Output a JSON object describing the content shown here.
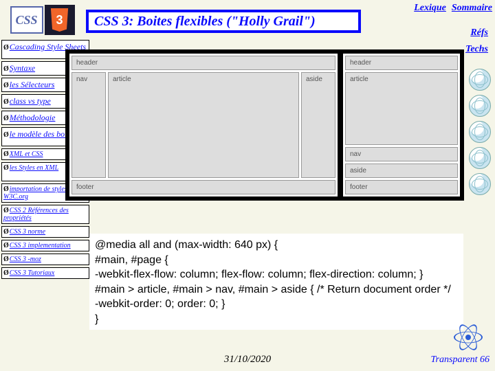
{
  "header": {
    "css_logo_text": "CSS",
    "shield_text": "3",
    "title": "CSS 3: Boites flexibles (\"Holly Grail\")",
    "lexique": "Lexique",
    "sommaire": "Sommaire",
    "refs": "Réfs",
    "techs": "Techs"
  },
  "sidebar": {
    "items": [
      "Cascading Style Sheets",
      "Syntaxe",
      "les Sélecteurs",
      "class vs type",
      "Méthodologie",
      "le modèle des boites",
      "XML et CSS",
      "les Styles en XML",
      "importation de styles W3C.org",
      "CSS 2 Références des propriétés",
      "CSS 3 norme",
      "CSS 3 implementation",
      "CSS 3 -moz",
      "CSS 3 Tutoriaux"
    ]
  },
  "diagram": {
    "left": {
      "header": "header",
      "nav": "nav",
      "article": "article",
      "aside": "aside",
      "footer": "footer"
    },
    "right": {
      "header": "header",
      "nav": "nav",
      "article": "article",
      "aside": "aside",
      "footer": "footer"
    }
  },
  "code": {
    "line1": "@media all and (max-width: 640 px) {",
    "line2": "#main, #page {",
    "line3": "-webkit-flex-flow: column; flex-flow: column; flex-direction: column; }",
    "line4": "#main > article, #main > nav, #main > aside { /* Return document order */",
    "line5": "-webkit-order: 0; order: 0; }",
    "line6": "}"
  },
  "footer": {
    "date": "31/10/2020",
    "slide": "Transparent 66"
  }
}
